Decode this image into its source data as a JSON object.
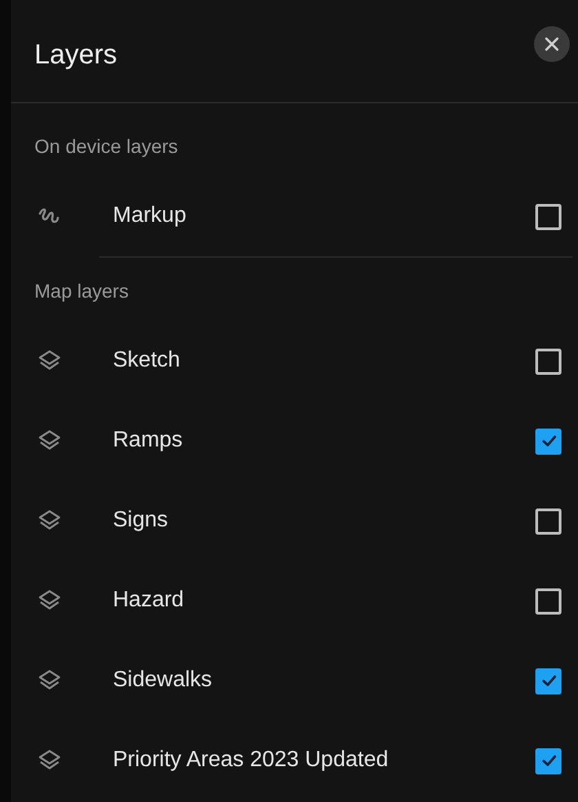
{
  "header": {
    "title": "Layers"
  },
  "sections": [
    {
      "heading": "On device layers",
      "items": [
        {
          "name": "Markup",
          "kind": "markup",
          "checked": false
        }
      ]
    },
    {
      "heading": "Map layers",
      "items": [
        {
          "name": "Sketch",
          "kind": "layer",
          "checked": false
        },
        {
          "name": "Ramps",
          "kind": "layer",
          "checked": true
        },
        {
          "name": "Signs",
          "kind": "layer",
          "checked": false
        },
        {
          "name": "Hazard",
          "kind": "layer",
          "checked": false
        },
        {
          "name": "Sidewalks",
          "kind": "layer",
          "checked": true
        },
        {
          "name": "Priority Areas 2023 Updated",
          "kind": "layer",
          "checked": true
        }
      ]
    }
  ]
}
